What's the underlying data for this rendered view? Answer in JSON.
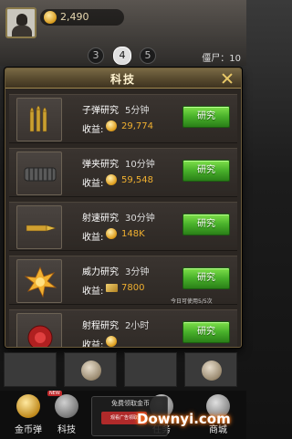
{
  "hud": {
    "coins": "2,490",
    "levels": [
      "3",
      "4",
      "5"
    ],
    "zombie_label": "僵尸：10"
  },
  "modal": {
    "title": "科技",
    "income_label": "收益:",
    "button_label": "研究",
    "rows": [
      {
        "name": "子弹研究",
        "time": "5分钟",
        "income": "29,774",
        "icon": "bullets-icon",
        "income_icon": "coin-icon"
      },
      {
        "name": "弹夹研究",
        "time": "10分钟",
        "income": "59,548",
        "icon": "magazine-icon",
        "income_icon": "coin-icon"
      },
      {
        "name": "射速研究",
        "time": "30分钟",
        "income": "148K",
        "icon": "bullet-speed-icon",
        "income_icon": "coin-icon"
      },
      {
        "name": "威力研究",
        "time": "3分钟",
        "income": "7800",
        "icon": "explosion-icon",
        "income_icon": "card-icon",
        "note": "今日可使用5/5次"
      },
      {
        "name": "射程研究",
        "time": "2小时",
        "income": "",
        "icon": "range-icon",
        "income_icon": "coin-icon"
      }
    ]
  },
  "bottom": {
    "nav": [
      {
        "label": "金币弹",
        "badge": ""
      },
      {
        "label": "科技",
        "badge": "NEW"
      },
      {
        "label": "任务",
        "badge": ""
      },
      {
        "label": "商城",
        "badge": ""
      }
    ],
    "free_coin": "免费领取金币",
    "free_coin_btn": "观看广告领取"
  },
  "watermark": "Downyi.com",
  "colors": {
    "accent_green": "#48b02a",
    "gold": "#f0b030",
    "header_brown": "#5a4c30"
  }
}
